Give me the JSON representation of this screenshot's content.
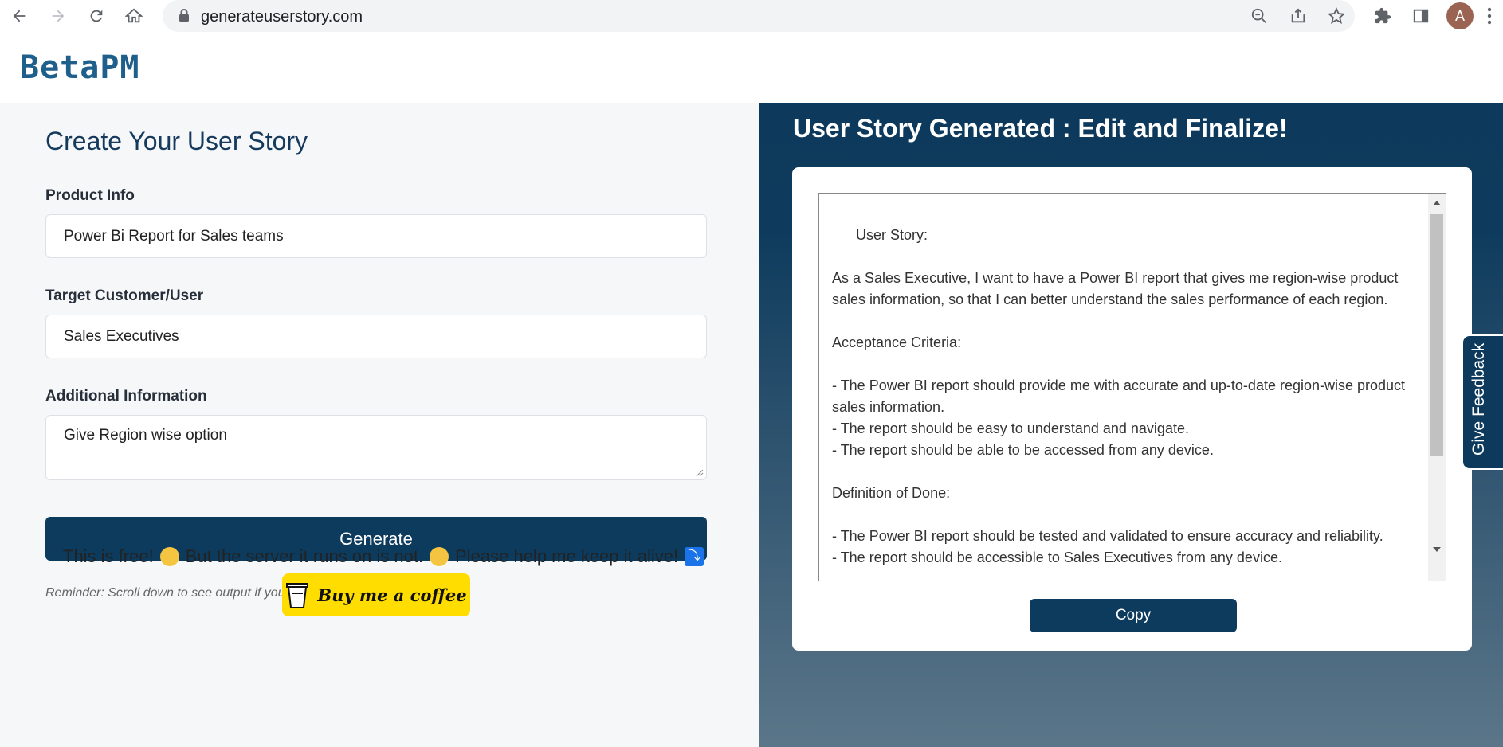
{
  "browser": {
    "url": "generateuserstory.com",
    "avatar_letter": "A"
  },
  "site": {
    "logo": "BetaPM"
  },
  "form": {
    "title": "Create Your User Story",
    "product_label": "Product Info",
    "product_value": "Power Bi Report for Sales teams",
    "target_label": "Target Customer/User",
    "target_value": "Sales Executives",
    "additional_label": "Additional Information",
    "additional_value": "Give Region wise option",
    "generate_label": "Generate",
    "reminder": "Reminder: Scroll down to see output if you are using mobile device!",
    "free_part1": "This is free!",
    "free_part2": "But the server it runs on is not.",
    "free_part3": "Please help me keep it alive!",
    "coffee_label": "Buy me a coffee"
  },
  "output": {
    "title": "User Story Generated : Edit and Finalize!",
    "story": "User Story:\n\nAs a Sales Executive, I want to have a Power BI report that gives me region-wise product sales information, so that I can better understand the sales performance of each region.\n\nAcceptance Criteria:\n\n- The Power BI report should provide me with accurate and up-to-date region-wise product sales information.\n- The report should be easy to understand and navigate.\n- The report should be able to be accessed from any device.\n\nDefinition of Done:\n\n- The Power BI report should be tested and validated to ensure accuracy and reliability.\n- The report should be accessible to Sales Executives from any device.",
    "copy_label": "Copy"
  },
  "feedback": {
    "label": "Give Feedback"
  }
}
